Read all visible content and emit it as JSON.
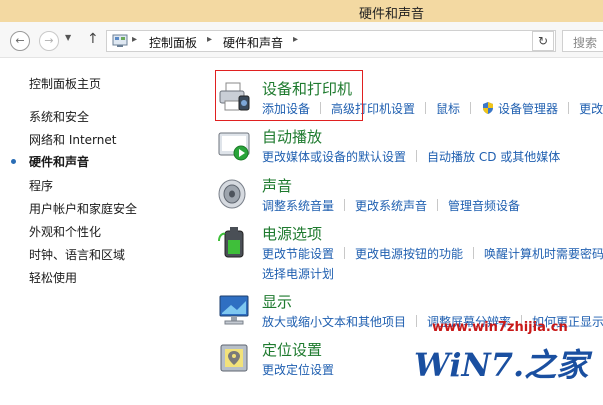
{
  "window": {
    "title": "硬件和声音"
  },
  "address": {
    "crumbs": [
      "控制面板",
      "硬件和声音"
    ],
    "search_placeholder": "搜索"
  },
  "sidebar": {
    "home": "控制面板主页",
    "items": [
      {
        "label": "系统和安全",
        "active": false
      },
      {
        "label": "网络和 Internet",
        "active": false
      },
      {
        "label": "硬件和声音",
        "active": true
      },
      {
        "label": "程序",
        "active": false
      },
      {
        "label": "用户帐户和家庭安全",
        "active": false
      },
      {
        "label": "外观和个性化",
        "active": false
      },
      {
        "label": "时钟、语言和区域",
        "active": false
      },
      {
        "label": "轻松使用",
        "active": false
      }
    ]
  },
  "categories": [
    {
      "title": "设备和打印机",
      "icon": "printer-icon",
      "links": [
        "添加设备",
        "高级打印机设置",
        "鼠标",
        "设备管理器",
        "更改"
      ],
      "links2": []
    },
    {
      "title": "自动播放",
      "icon": "autoplay-icon",
      "links": [
        "更改媒体或设备的默认设置",
        "自动播放 CD 或其他媒体"
      ],
      "links2": []
    },
    {
      "title": "声音",
      "icon": "speaker-icon",
      "links": [
        "调整系统音量",
        "更改系统声音",
        "管理音频设备"
      ],
      "links2": []
    },
    {
      "title": "电源选项",
      "icon": "battery-icon",
      "links": [
        "更改节能设置",
        "更改电源按钮的功能",
        "唤醒计算机时需要密码"
      ],
      "links2": [
        "选择电源计划"
      ]
    },
    {
      "title": "显示",
      "icon": "display-icon",
      "links": [
        "放大或缩小文本和其他项目",
        "调整屏幕分辨率",
        "如何更正显示"
      ],
      "links2": []
    },
    {
      "title": "定位设置",
      "icon": "location-icon",
      "links": [
        "更改定位设置"
      ],
      "links2": []
    }
  ],
  "watermark": {
    "url": "www.win7zhijia.cn",
    "logo": "WiN7.之家"
  },
  "colors": {
    "title_bar": "#f3d9a2",
    "link": "#1f5fb0",
    "category_title": "#1e7a2e",
    "highlight": "#e02020",
    "watermark_red": "#c81818",
    "watermark_blue": "#1a4fa0"
  }
}
